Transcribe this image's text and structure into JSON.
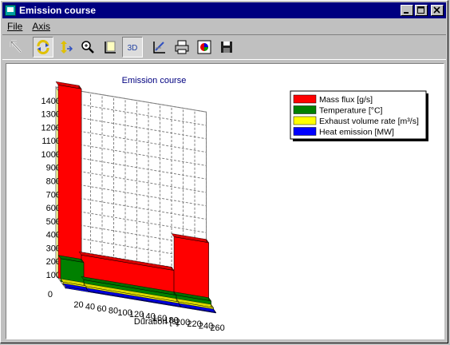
{
  "window": {
    "title": "Emission course"
  },
  "menu": {
    "file_label": "File",
    "axis_label": "Axis"
  },
  "toolbar": {
    "buttons": [
      {
        "icon": "arrow-pointer-icon"
      },
      {
        "icon": "rotate-icon",
        "pressed": true
      },
      {
        "icon": "updown-scale-icon"
      },
      {
        "icon": "zoom-icon"
      },
      {
        "icon": "axes-icon"
      },
      {
        "icon": "3d-toggle-icon",
        "label": "3D",
        "pressed": true
      },
      {
        "icon": "edit-chart-icon"
      },
      {
        "icon": "printer-icon"
      },
      {
        "icon": "chart-properties-icon"
      },
      {
        "icon": "save-disk-icon"
      }
    ]
  },
  "chart_data": {
    "type": "area",
    "title": "Emission course",
    "xlabel": "Duration [s]",
    "ylabel": "",
    "three_d": true,
    "grid": true,
    "legend_position": "top-right",
    "ylim": [
      0,
      1400
    ],
    "xlim": [
      0,
      260
    ],
    "yticks": [
      100,
      200,
      300,
      400,
      500,
      600,
      700,
      800,
      900,
      1000,
      1100,
      1200,
      1300,
      1400
    ],
    "y_zero_label": "0",
    "xticks": [
      20,
      40,
      60,
      80,
      100,
      120,
      140,
      160,
      180,
      200,
      220,
      240,
      260
    ],
    "series": [
      {
        "name": "Mass flux [g/s]",
        "color": "#ff0000",
        "steps": [
          [
            0,
            40,
            1440
          ],
          [
            40,
            200,
            200
          ],
          [
            200,
            260,
            450
          ]
        ]
      },
      {
        "name": "Temperature [°C]",
        "color": "#008000",
        "steps": [
          [
            0,
            40,
            170
          ],
          [
            40,
            200,
            40
          ],
          [
            200,
            260,
            40
          ]
        ]
      },
      {
        "name": "Exhaust volume rate [m³/s]",
        "color": "#ffff00",
        "steps": [
          [
            0,
            40,
            20
          ],
          [
            40,
            200,
            15
          ],
          [
            200,
            260,
            15
          ]
        ]
      },
      {
        "name": "Heat emission [MW]",
        "color": "#0000ff",
        "steps": [
          [
            0,
            40,
            10
          ],
          [
            40,
            200,
            5
          ],
          [
            200,
            260,
            5
          ]
        ]
      }
    ]
  }
}
